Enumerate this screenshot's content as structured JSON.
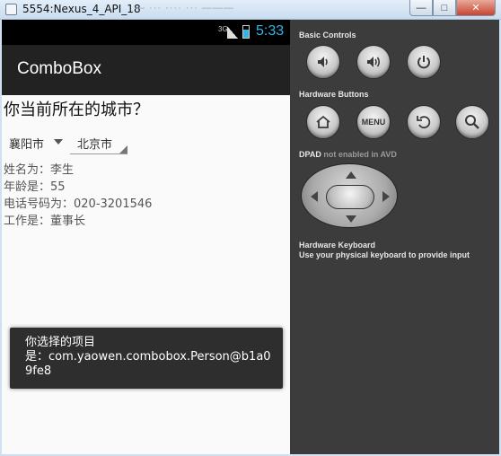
{
  "window": {
    "title": "5554:Nexus_4_API_18",
    "faint_title": "— ··· ···· ··· ———",
    "minimize": "—",
    "maximize": "□",
    "close": "✕"
  },
  "statusbar": {
    "network": "3G",
    "time": "5:33",
    "accent": "#33b5e5"
  },
  "app": {
    "title": "ComboBox"
  },
  "content": {
    "question": "你当前所在的城市？",
    "spinner1": "襄阳市",
    "spinner2": "北京市",
    "info": [
      "姓名为：李生",
      "年龄是：55",
      "电话号码为：020-3201546",
      "工作是：董事长"
    ]
  },
  "toast": {
    "line1": "你选择的项目",
    "line2": "是：com.yaowen.combobox.Person@b1a0",
    "line3": "9fe8"
  },
  "panel": {
    "basic_controls": "Basic Controls",
    "hardware_buttons": "Hardware Buttons",
    "menu_label": "MENU",
    "dpad_label": "DPAD",
    "dpad_note": "not enabled in AVD",
    "keyboard_title": "Hardware Keyboard",
    "keyboard_note": "Use your physical keyboard to provide input"
  }
}
